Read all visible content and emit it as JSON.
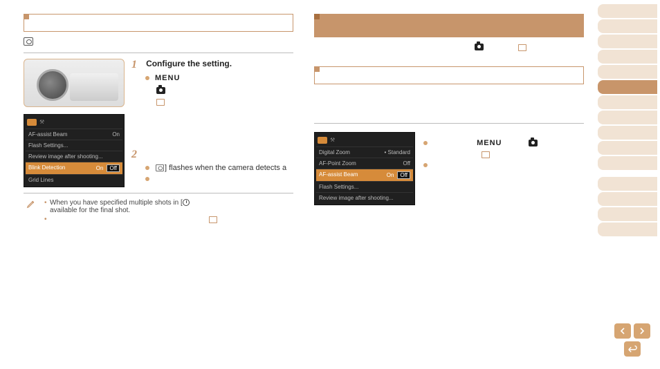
{
  "left": {
    "section_title": "",
    "icon_desc": "blink-detect-icon",
    "step1": {
      "number": "1",
      "title": "Configure the setting.",
      "menu_label": "MENU"
    },
    "step2": {
      "number": "2",
      "title": "",
      "detect_text": "] flashes when the camera detects a"
    },
    "camera_menu_rows": [
      {
        "label": "AF-assist Beam",
        "value": "On",
        "sel": false
      },
      {
        "label": "Flash Settings...",
        "value": "",
        "sel": false
      },
      {
        "label": "Review image after shooting...",
        "value": "",
        "sel": false
      },
      {
        "label": "Blink Detection",
        "value_on": "On",
        "value_off": "Off",
        "sel": true
      },
      {
        "label": "Grid Lines",
        "value": "",
        "sel": false
      }
    ],
    "notes": [
      "When you have specified multiple shots in [",
      "available for the final shot.",
      "",
      ""
    ]
  },
  "right": {
    "section1_title": "",
    "section2_title": "",
    "menu_label": "MENU",
    "camera_menu_rows": [
      {
        "label": "Digital Zoom",
        "value": "• Standard",
        "sel": false
      },
      {
        "label": "AF-Point Zoom",
        "value": "Off",
        "sel": false
      },
      {
        "label": "AF-assist Beam",
        "value_on": "On",
        "value_off": "Off",
        "sel": true
      },
      {
        "label": "Flash Settings...",
        "value": "",
        "sel": false
      },
      {
        "label": "Review image after shooting...",
        "value": "",
        "sel": false
      }
    ]
  },
  "sidebar_items": [
    {
      "active": false
    },
    {
      "active": false
    },
    {
      "active": false
    },
    {
      "active": false
    },
    {
      "active": false
    },
    {
      "active": true
    },
    {
      "active": false
    },
    {
      "active": false
    },
    {
      "active": false
    },
    {
      "active": false
    },
    {
      "active": false
    },
    {
      "active": false
    },
    {
      "active": false
    },
    {
      "active": false
    },
    {
      "active": false
    }
  ]
}
